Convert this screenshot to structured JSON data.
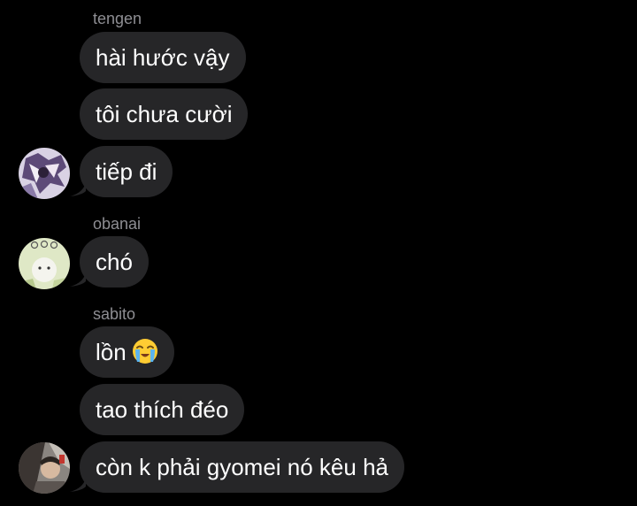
{
  "chat": {
    "messages": [
      {
        "sender": "tengen",
        "text": "hài hước vậy"
      },
      {
        "text": "tôi chưa cười"
      },
      {
        "text": "tiếp đi"
      },
      {
        "sender": "obanai",
        "text": "chó"
      },
      {
        "sender": "sabito",
        "text": "lồn",
        "emoji": "loudly-crying-face"
      },
      {
        "text": "tao thích đéo"
      },
      {
        "text": "còn k phải gyomei nó kêu hả"
      }
    ]
  },
  "colors": {
    "background": "#000000",
    "bubble": "#262628",
    "text": "#ffffff",
    "sender": "#8e8e93"
  }
}
